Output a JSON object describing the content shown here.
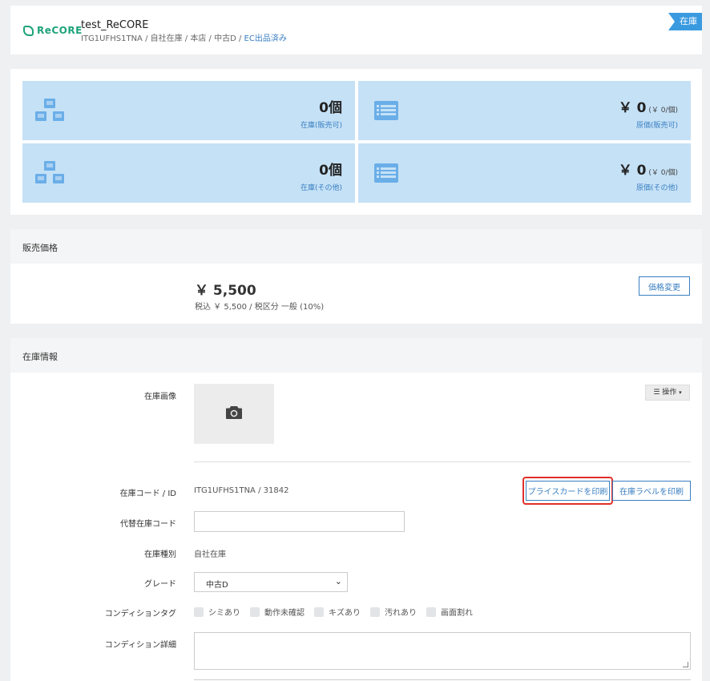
{
  "header": {
    "logo_text": "ReCORE",
    "title": "test_ReCORE",
    "breadcrumb_prefix": "ITG1UFHS1TNA / 自社在庫 / 本店 / 中古D / ",
    "breadcrumb_link": "EC出品済み",
    "status_ribbon": "在庫"
  },
  "stats": {
    "tiles": [
      {
        "value": "0個",
        "caption": "在庫(販売可)",
        "icon": "boxes-icon"
      },
      {
        "value": "￥ 0",
        "sub": " (￥ 0/個)",
        "caption": "原価(販売可)",
        "icon": "list-icon"
      },
      {
        "value": "0個",
        "caption": "在庫(その他)",
        "icon": "boxes-icon"
      },
      {
        "value": "￥ 0",
        "sub": " (￥ 0/個)",
        "caption": "原価(その他)",
        "icon": "list-icon"
      }
    ]
  },
  "price": {
    "section_title": "販売価格",
    "amount": "￥ 5,500",
    "tax_line": "税込 ￥ 5,500 / 税区分 一般 (10%)",
    "change_button": "価格変更"
  },
  "stock": {
    "section_title": "在庫情報",
    "image_label": "在庫画像",
    "ops_button": "操作",
    "code_label": "在庫コード / ID",
    "code_value": "ITG1UFHS1TNA / 31842",
    "print_price_card": "プライスカードを印刷",
    "print_stock_label": "在庫ラベルを印刷",
    "alt_code_label": "代替在庫コード",
    "alt_code_value": "",
    "type_label": "在庫種別",
    "type_value": "自社在庫",
    "grade_label": "グレード",
    "grade_value": "中古D",
    "condition_tags_label": "コンディションタグ",
    "condition_tags": [
      "シミあり",
      "動作未確認",
      "キズあり",
      "汚れあり",
      "画面割れ"
    ],
    "condition_detail_label": "コンディション詳細",
    "condition_detail_value": ""
  },
  "colors": {
    "accent": "#3a7fc1",
    "brand": "#1ea37a",
    "tile": "#c5e1f6",
    "highlight": "#e0302a",
    "ribbon": "#3a9ae0"
  }
}
